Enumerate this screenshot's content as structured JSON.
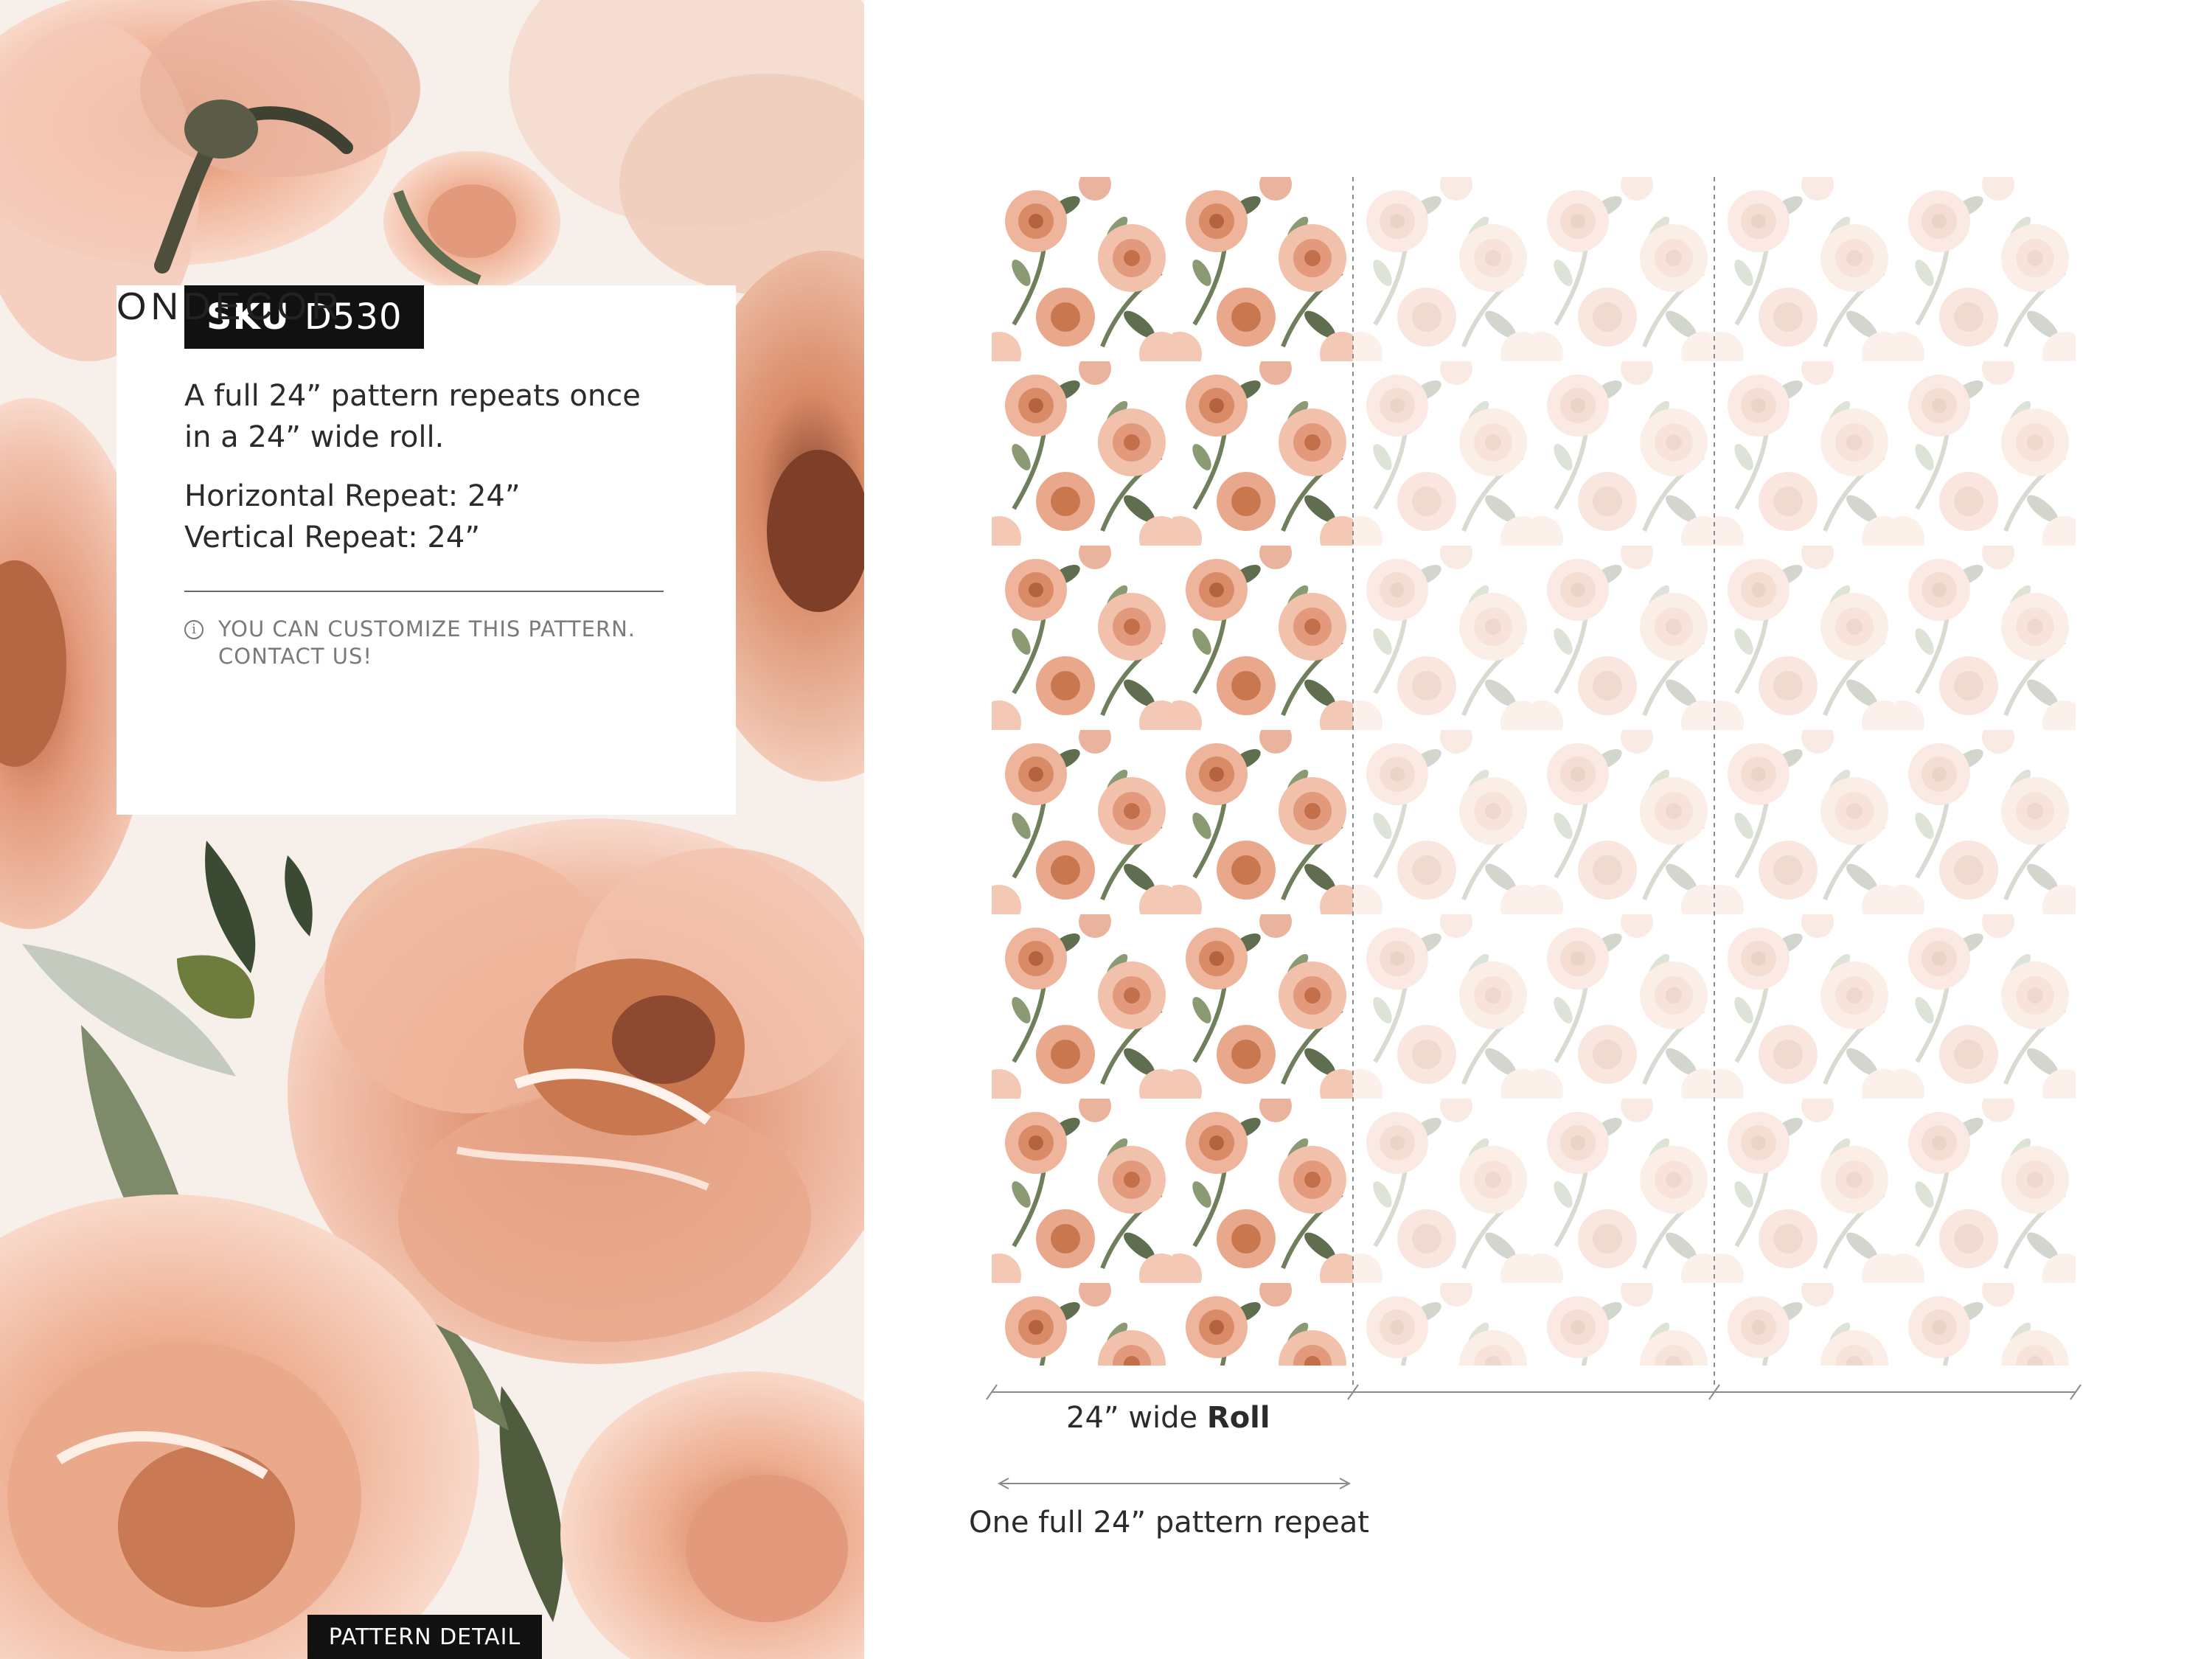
{
  "sku": {
    "key": "SKU",
    "value": "D530"
  },
  "description": {
    "line1": "A full 24” pattern repeats once",
    "line2": "in a 24” wide roll."
  },
  "repeats": {
    "horizontal": "Horizontal Repeat: 24”",
    "vertical": "Vertical Repeat: 24”"
  },
  "notice": {
    "icon": "info-icon",
    "line1": "YOU CAN CUSTOMIZE THIS PATTERN.",
    "line2": "CONTACT US!"
  },
  "brand": "ONDECOR",
  "pattern_detail_label": "PATTERN DETAIL",
  "dimensions": {
    "roll_prefix": "24” wide ",
    "roll_bold": "Roll",
    "repeat_label": "One full 24” pattern repeat"
  },
  "colors": {
    "peach": "#e9a88c",
    "blush": "#f3c9b6",
    "rust": "#c9774f",
    "leaf": "#5e6e4e",
    "sage": "#b7c2b3"
  },
  "rolls": [
    {
      "state": "full"
    },
    {
      "state": "faded"
    },
    {
      "state": "faded"
    }
  ]
}
